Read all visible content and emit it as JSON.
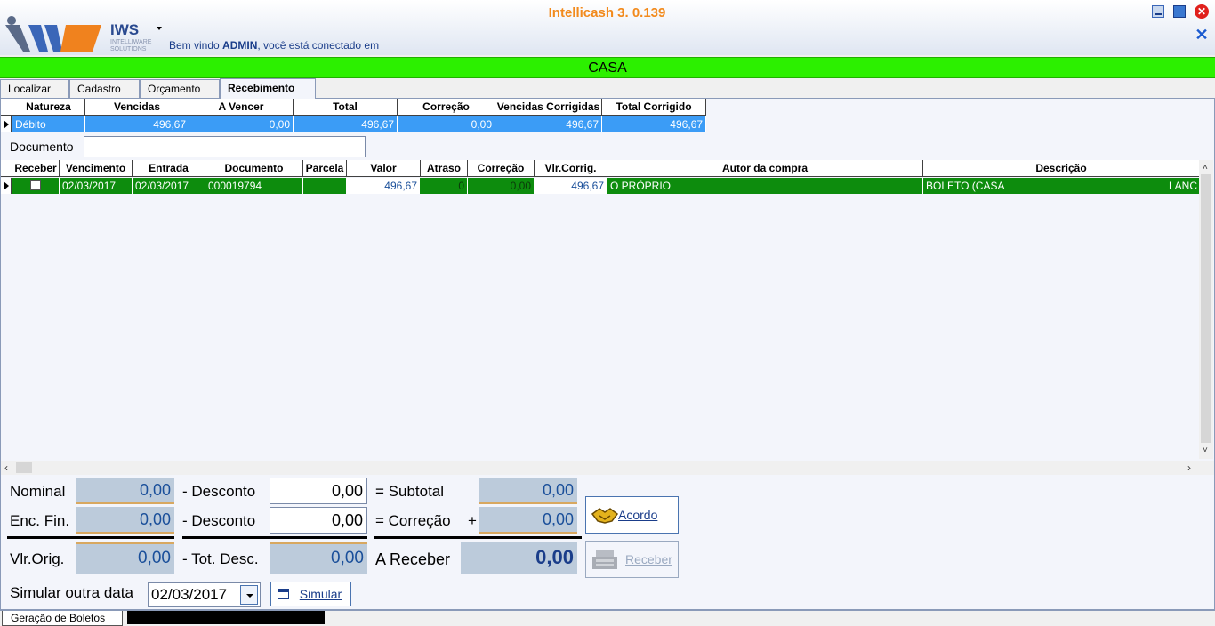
{
  "header": {
    "app_title": "Intellicash 3. 0.139",
    "logo_text": "IWS",
    "logo_sub": "INTELLIWARE SOLUTIONS",
    "welcome_prefix": "Bem vindo ",
    "welcome_user": "ADMIN",
    "welcome_suffix": ", você está conectado em"
  },
  "store_banner": "CASA",
  "tabs": [
    {
      "label": "Localizar"
    },
    {
      "label": "Cadastro"
    },
    {
      "label": "Orçamento"
    },
    {
      "label": "Recebimento"
    }
  ],
  "summary": {
    "headers": [
      "Natureza",
      "Vencidas",
      "A Vencer",
      "Total",
      "Correção",
      "Vencidas Corrigidas",
      "Total Corrigido"
    ],
    "row": [
      "Débito",
      "496,67",
      "0,00",
      "496,67",
      "0,00",
      "496,67",
      "496,67"
    ]
  },
  "document": {
    "label": "Documento",
    "value": ""
  },
  "installments": {
    "headers": [
      "Receber",
      "Vencimento",
      "Entrada",
      "Documento",
      "Parcela",
      "Valor",
      "Atraso",
      "Correção",
      "Vlr.Corrig.",
      "Autor da compra",
      "Descrição"
    ],
    "rows": [
      {
        "vencimento": "02/03/2017",
        "entrada": "02/03/2017",
        "documento": "000019794",
        "parcela": "",
        "valor": "496,67",
        "atraso": "0",
        "correcao": "0,00",
        "vlr_corrig": "496,67",
        "autor": "O PRÓPRIO",
        "descricao": "BOLETO (CASA",
        "extra": "LANC"
      }
    ]
  },
  "totals": {
    "nominal_label": "Nominal",
    "nominal": "0,00",
    "desconto1_label": "- Desconto",
    "desconto1": "0,00",
    "subtotal_label": "= Subtotal",
    "subtotal": "0,00",
    "encfin_label": "Enc. Fin.",
    "encfin": "0,00",
    "desconto2_label": "- Desconto",
    "desconto2": "0,00",
    "correcao_label": "= Correção",
    "plus": "+",
    "correcao": "0,00",
    "vlrorig_label": "Vlr.Orig.",
    "vlrorig": "0,00",
    "totdesc_label": "- Tot. Desc.",
    "totdesc": "0,00",
    "areceber_label": "A Receber",
    "areceber": "0,00"
  },
  "buttons": {
    "acordo": "Acordo",
    "receber": "Receber",
    "simular": "Simular"
  },
  "simulate": {
    "label": "Simular outra data",
    "date": "02/03/2017"
  },
  "bottom_tabs": [
    {
      "label": "Geração de Boletos"
    }
  ],
  "colors": {
    "title": "#f28a1c",
    "banner": "#2cf000",
    "selected_row": "#0d8c0d",
    "summary_row": "#3b9cf6"
  }
}
